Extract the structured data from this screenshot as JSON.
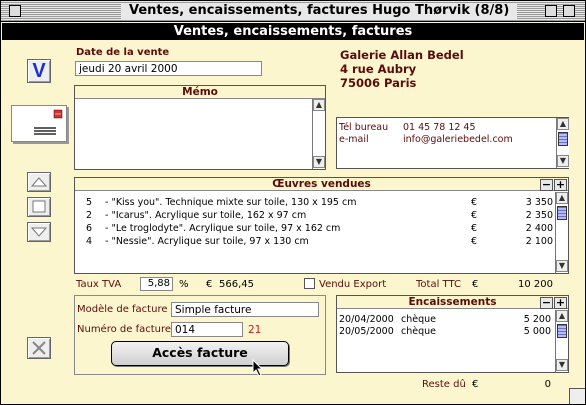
{
  "window": {
    "title": "Ventes, encaissements, factures Hugo Thørvik (8/8)"
  },
  "header": {
    "title": "Ventes, encaissements, factures"
  },
  "toolbar": {
    "validate_glyph": "V",
    "icons": [
      "checkmark-v-icon",
      "envelope-icon",
      "up-arrow-icon",
      "square-icon",
      "down-arrow-icon",
      "delete-x-icon"
    ]
  },
  "sale": {
    "date_label": "Date de la vente",
    "date_value": "jeudi 20 avril 2000"
  },
  "gallery": {
    "name": "Galerie Allan Bedel",
    "address1": "4 rue Aubry",
    "address2": "75006 Paris",
    "phone_label": "Tél bureau",
    "phone_value": "01 45 78 12 45",
    "email_label": "e-mail",
    "email_value": "info@galeriebedel.com"
  },
  "memo": {
    "title": "Mémo",
    "text": ""
  },
  "works": {
    "title": "Œuvres vendues",
    "items": [
      {
        "qty": "5",
        "desc": "- \"Kiss you\". Technique mixte sur toile, 130 x 195 cm",
        "currency": "€",
        "price": "3 350"
      },
      {
        "qty": "2",
        "desc": "- \"Icarus\". Acrylique sur toile, 162 x 97 cm",
        "currency": "€",
        "price": "2 350"
      },
      {
        "qty": "6",
        "desc": "- \"Le troglodyte\". Acrylique sur toile, 97 x 162 cm",
        "currency": "€",
        "price": "2 400"
      },
      {
        "qty": "4",
        "desc": "- \"Nessie\". Acrylique sur toile, 97 x 130 cm",
        "currency": "€",
        "price": "2 100"
      }
    ]
  },
  "totals": {
    "tva_label": "Taux TVA",
    "tva_rate": "5,88",
    "percent": "%",
    "currency": "€",
    "tva_amount": "566,45",
    "export_label": "Vendu Export",
    "total_label": "Total TTC",
    "total_currency": "€",
    "total_value": "10 200"
  },
  "invoice": {
    "model_label": "Modèle de facture",
    "model_value": "Simple facture",
    "number_label": "Numéro de facture",
    "number_value": "014",
    "number_suffix": "21",
    "access_button": "Accès facture"
  },
  "payments": {
    "title": "Encaissements",
    "items": [
      {
        "date": "20/04/2000",
        "method": "chèque",
        "amount": "5 200"
      },
      {
        "date": "20/05/2000",
        "method": "chèque",
        "amount": "5 000"
      }
    ],
    "remaining_label": "Reste dû",
    "remaining_currency": "€",
    "remaining_value": "0"
  },
  "colors": {
    "background": "#fcf6cf",
    "accent_text": "#5a0c0c",
    "validate_blue": "#1a2fd0",
    "invoice_suffix": "#c8201e"
  }
}
